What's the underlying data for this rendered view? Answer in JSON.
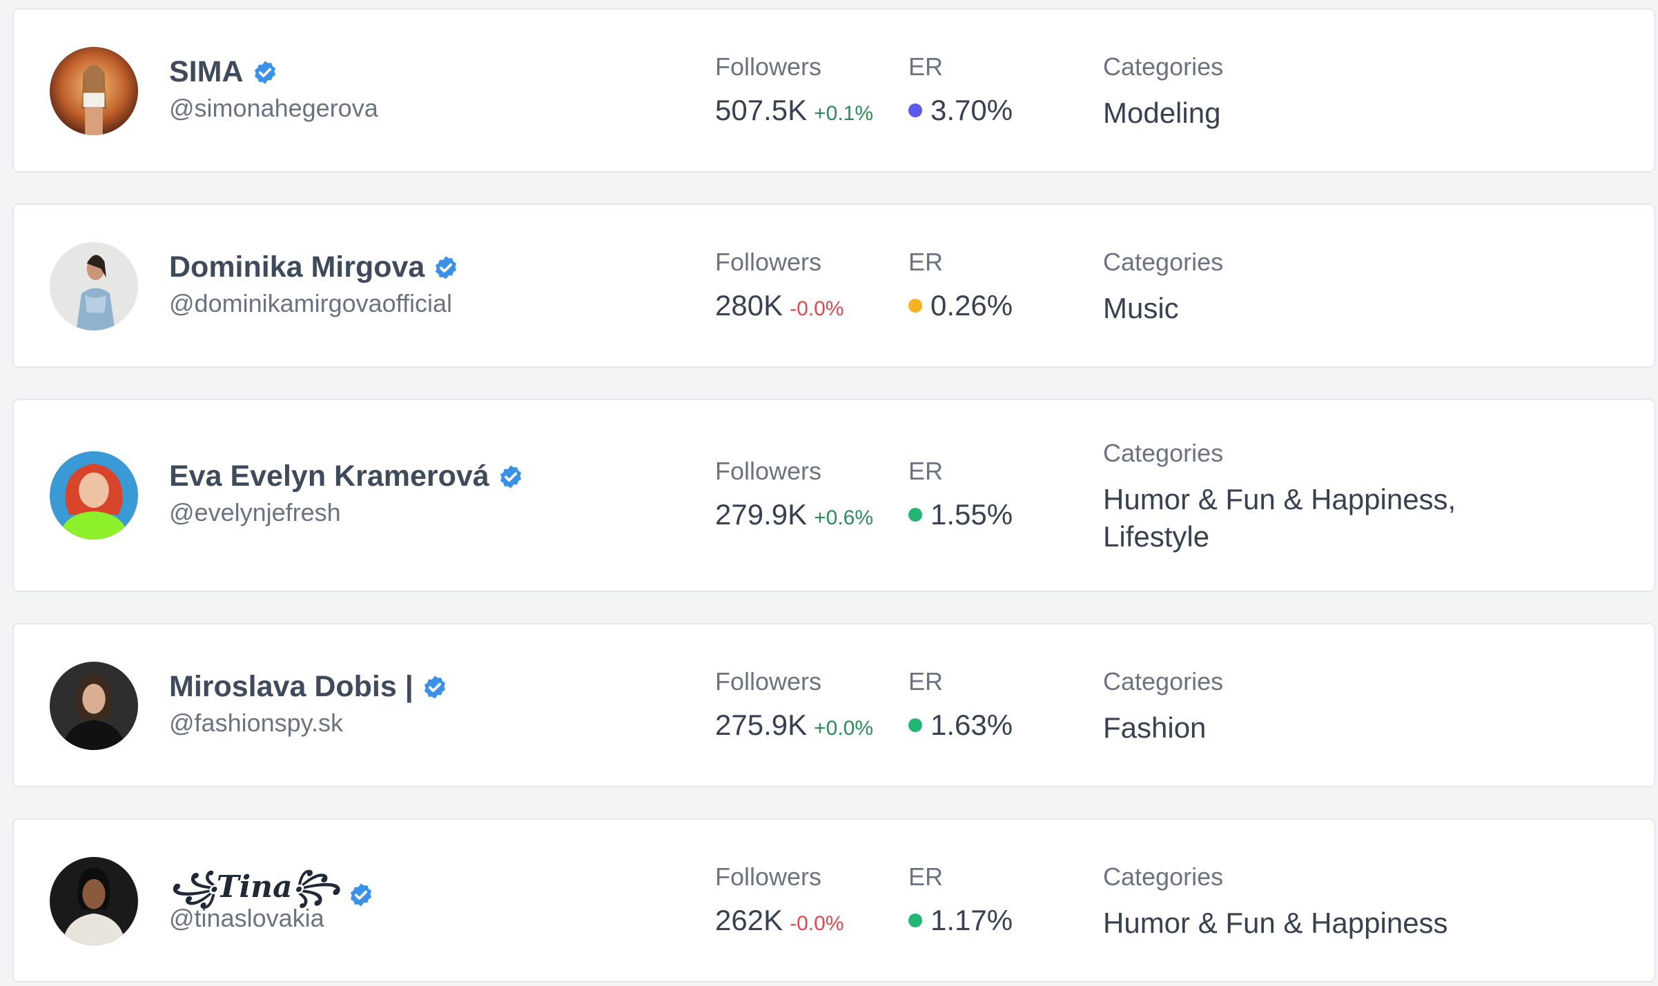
{
  "labels": {
    "followers": "Followers",
    "er": "ER",
    "categories": "Categories"
  },
  "influencers": [
    {
      "name": "SIMA",
      "handle": "@simonahegerova",
      "followers": "507.5K",
      "followers_change": "+0.1%",
      "er": "3.70%",
      "er_color": "#5b5bea",
      "categories": "Modeling"
    },
    {
      "name": "Dominika Mirgova",
      "handle": "@dominikamirgovaofficial",
      "followers": "280K",
      "followers_change": "-0.0%",
      "er": "0.26%",
      "er_color": "#f5b324",
      "categories": "Music"
    },
    {
      "name": "Eva Evelyn Kramerová",
      "handle": "@evelynjefresh",
      "followers": "279.9K",
      "followers_change": "+0.6%",
      "er": "1.55%",
      "er_color": "#22b573",
      "categories": "Humor & Fun & Happiness, Lifestyle"
    },
    {
      "name": "Miroslava Dobis |",
      "handle": "@fashionspy.sk",
      "followers": "275.9K",
      "followers_change": "+0.0%",
      "er": "1.63%",
      "er_color": "#22b573",
      "categories": "Fashion"
    },
    {
      "name": "꧁Tina꧂",
      "handle": "@tinaslovakia",
      "followers": "262K",
      "followers_change": "-0.0%",
      "er": "1.17%",
      "er_color": "#22b573",
      "categories": "Humor & Fun & Happiness"
    }
  ],
  "colors": {
    "verified": "#3b91e8",
    "positive": "#2e8b57",
    "negative": "#e0484f"
  },
  "icons": {
    "verified": "verified-badge-icon",
    "avatar": "profile-photo"
  }
}
